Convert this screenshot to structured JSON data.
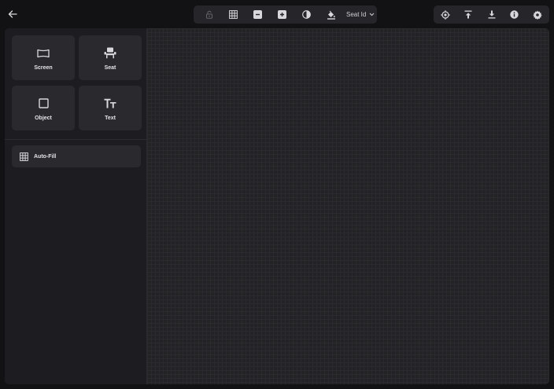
{
  "toolbar": {
    "seat_select": {
      "value": "Seat Id"
    }
  },
  "sidebar": {
    "tiles": [
      {
        "label": "Screen",
        "icon": "screen-icon"
      },
      {
        "label": "Seat",
        "icon": "seat-icon"
      },
      {
        "label": "Object",
        "icon": "square-icon"
      },
      {
        "label": "Text",
        "icon": "text-icon"
      }
    ],
    "autofill": {
      "label": "Auto-Fill",
      "icon": "grid-icon"
    }
  },
  "colors": {
    "background": "#121214",
    "panel": "#1d1d21",
    "tile": "#2a2a2e",
    "toolbar": "#26262a",
    "canvas": "#232326",
    "icon": "#d8d8dc"
  }
}
